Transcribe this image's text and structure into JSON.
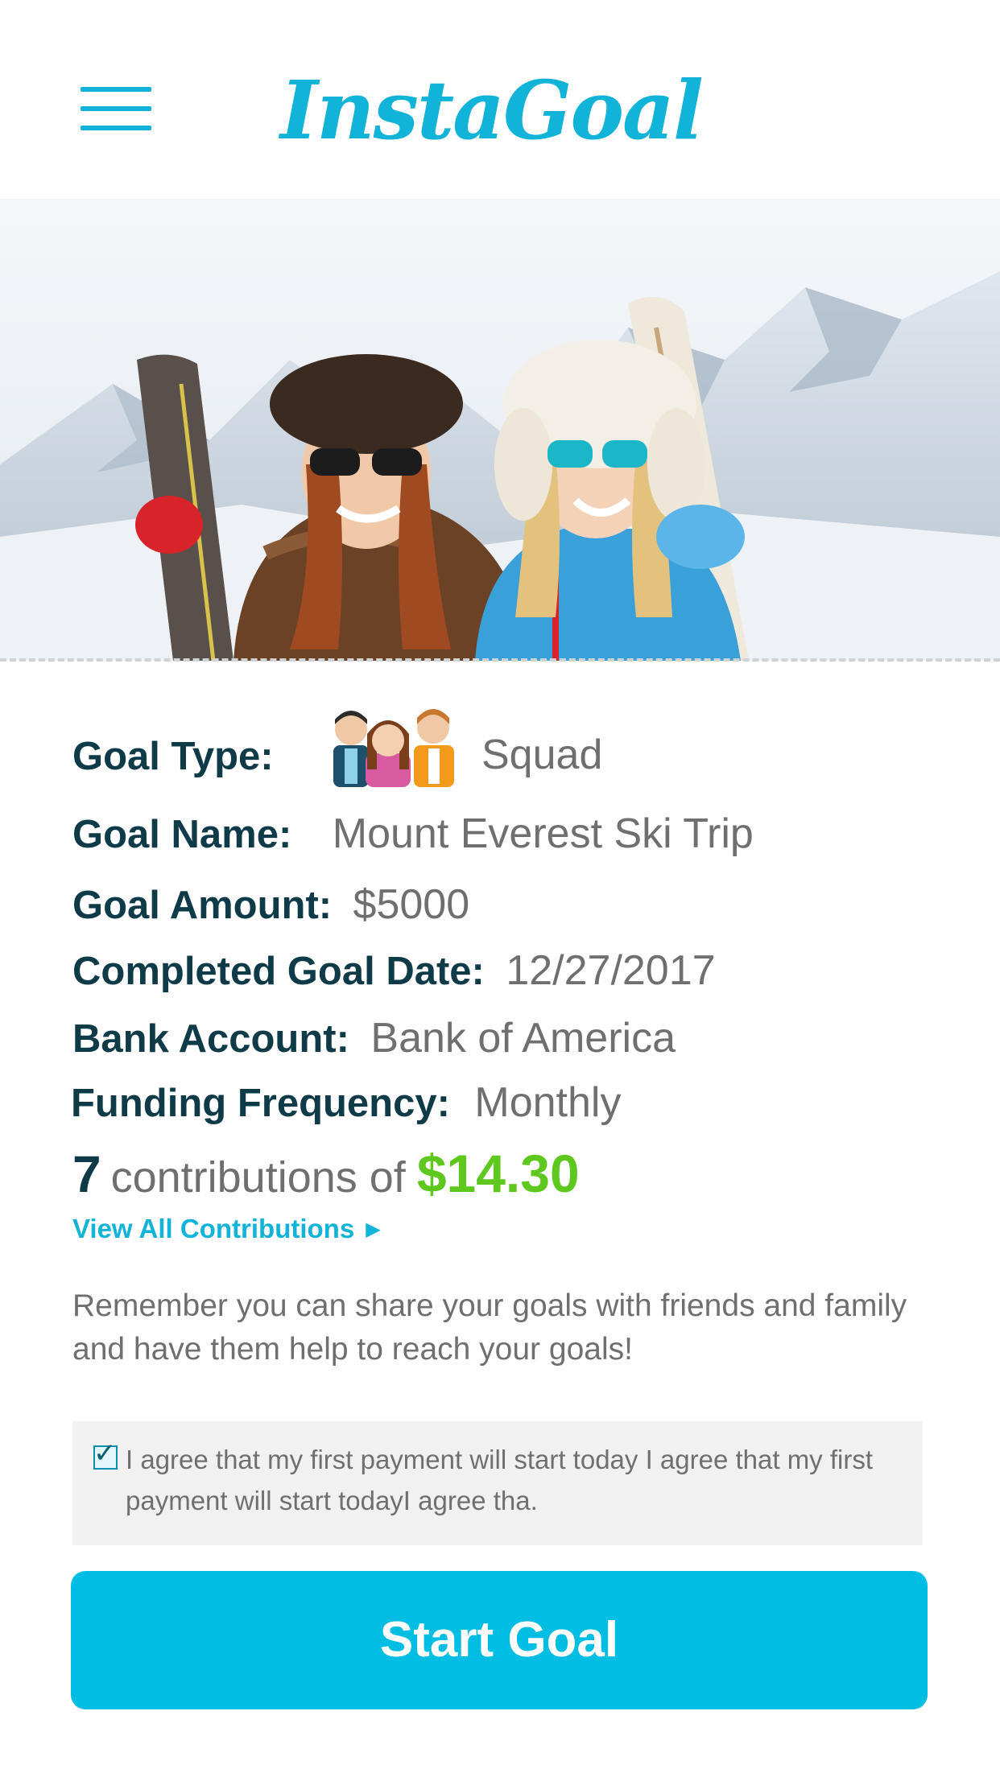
{
  "header": {
    "menu_icon": "hamburger-menu-icon",
    "logo_text": "InstaGoal"
  },
  "hero": {
    "image": "photo of two smiling women in winter jackets holding skis on a snowy mountain"
  },
  "details": {
    "goal_type_label": "Goal Type:",
    "goal_type_icon": "squad-people-icon",
    "goal_type_value": "Squad",
    "goal_name_label": "Goal Name:",
    "goal_name_value": "Mount Everest Ski Trip",
    "goal_amount_label": "Goal Amount:",
    "goal_amount_value": "$5000",
    "completed_date_label": "Completed Goal Date:",
    "completed_date_value": "12/27/2017",
    "bank_label": "Bank Account:",
    "bank_value": "Bank of America",
    "frequency_label": "Funding Frequency:",
    "frequency_value": "Monthly"
  },
  "contributions": {
    "count": "7",
    "text": "contributions of",
    "amount": "$14.30",
    "view_all_label": "View All Contributions"
  },
  "remember_text": "Remember you can share your goals with friends and family and have them help to reach your goals!",
  "agreement": {
    "checked": true,
    "text": "I agree that my first payment will start today I agree that my first payment will start todayI agree tha."
  },
  "start_button_label": "Start Goal",
  "colors": {
    "accent": "#12b3d8",
    "button": "#00bde3",
    "label": "#0f3b48",
    "value": "#6f6f6f",
    "amount": "#5ec81e"
  }
}
